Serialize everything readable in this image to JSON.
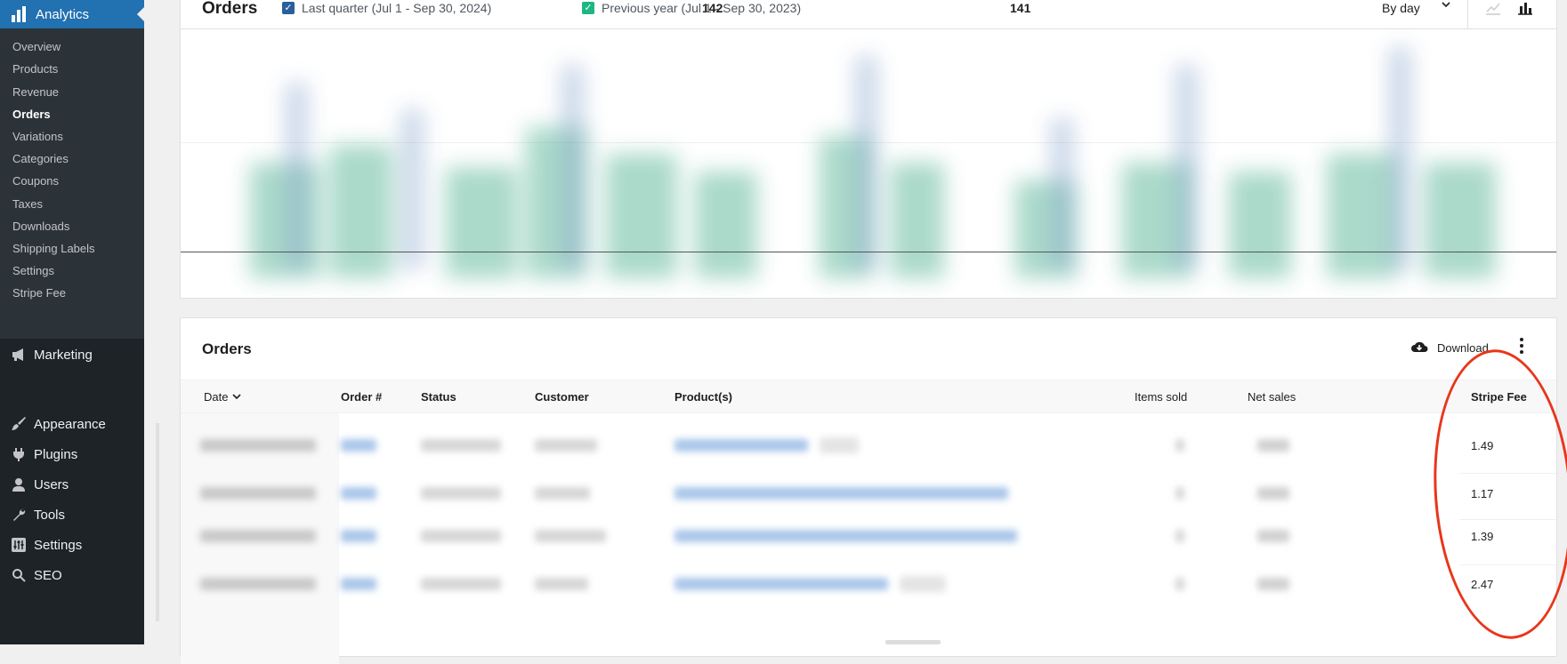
{
  "sidebar": {
    "current": {
      "label": "Analytics",
      "icon": "bar-chart-icon"
    },
    "submenu": [
      "Overview",
      "Products",
      "Revenue",
      "Orders",
      "Variations",
      "Categories",
      "Coupons",
      "Taxes",
      "Downloads",
      "Shipping Labels",
      "Settings",
      "Stripe Fee"
    ],
    "submenu_current": "Orders",
    "menu": [
      {
        "label": "Marketing",
        "icon": "megaphone-icon"
      },
      {
        "label": "Appearance",
        "icon": "paintbrush-icon"
      },
      {
        "label": "Plugins",
        "icon": "plugin-icon"
      },
      {
        "label": "Users",
        "icon": "user-icon"
      },
      {
        "label": "Tools",
        "icon": "wrench-icon"
      },
      {
        "label": "Settings",
        "icon": "sliders-icon"
      },
      {
        "label": "SEO",
        "icon": "search-icon"
      }
    ]
  },
  "chart": {
    "title": "Orders",
    "legend": [
      {
        "label": "Last quarter (Jul 1 - Sep 30, 2024)",
        "total": "142",
        "color": "#3858e9"
      },
      {
        "label": "Previous year (Jul 1 - Sep 30, 2023)",
        "total": "141",
        "color": "#1eb682"
      }
    ],
    "interval": "By day",
    "type_buttons": [
      "line-chart-icon",
      "bar-chart-icon"
    ]
  },
  "table": {
    "title": "Orders",
    "download_label": "Download",
    "columns": {
      "date": "Date",
      "order": "Order #",
      "status": "Status",
      "customer": "Customer",
      "products": "Product(s)",
      "items_sold": "Items sold",
      "net_sales": "Net sales",
      "stripe_fee": "Stripe Fee"
    },
    "stripe_fees": [
      "1.49",
      "1.17",
      "1.39",
      "2.47"
    ]
  },
  "colors": {
    "sidebar_bg": "#1d2327",
    "accent": "#2271b1",
    "annotation": "#e8361a"
  }
}
